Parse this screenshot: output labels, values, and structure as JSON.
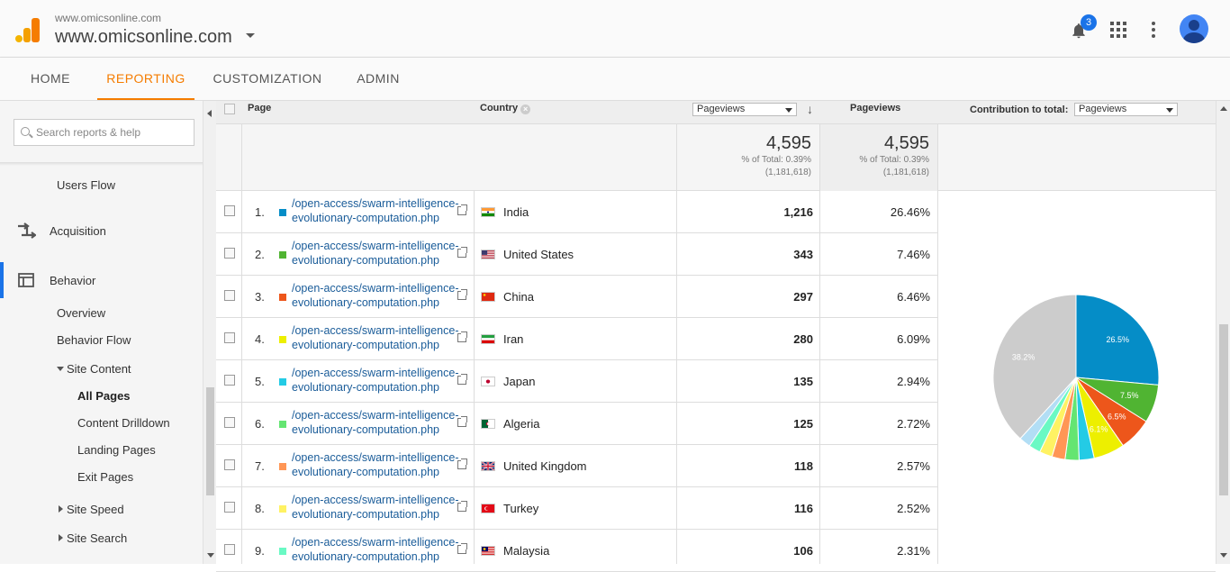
{
  "header": {
    "account_small": "www.omicsonline.com",
    "account_name": "www.omicsonline.com",
    "notifications_count": "3",
    "icons": [
      "analytics-logo-icon",
      "bell-icon",
      "apps-grid-icon",
      "more-vert-icon",
      "avatar-icon"
    ]
  },
  "nav": {
    "tabs": [
      "HOME",
      "REPORTING",
      "CUSTOMIZATION",
      "ADMIN"
    ],
    "active": "REPORTING",
    "accent_color": "#f57c00"
  },
  "sidebar": {
    "search_placeholder": "Search reports & help",
    "users_flow": "Users Flow",
    "acquisition": "Acquisition",
    "behavior": "Behavior",
    "overview": "Overview",
    "behavior_flow": "Behavior Flow",
    "site_content": "Site Content",
    "all_pages": "All Pages",
    "content_drilldown": "Content Drilldown",
    "landing_pages": "Landing Pages",
    "exit_pages": "Exit Pages",
    "site_speed": "Site Speed",
    "site_search": "Site Search",
    "accent_color": "#1a73e8"
  },
  "table": {
    "headers": {
      "page": "Page",
      "country": "Country",
      "metric_select": "Pageviews",
      "pageviews": "Pageviews",
      "contribution": "Contribution to total:",
      "contribution_select": "Pageviews"
    },
    "totals": {
      "value1": "4,595",
      "pct1": "% of Total: 0.39%",
      "base1": "(1,181,618)",
      "value2": "4,595",
      "pct2": "% of Total: 0.39%",
      "base2": "(1,181,618)"
    },
    "rows": [
      {
        "num": "1.",
        "page": "/open-access/swarm-intelligence-evolutionary-computation.php",
        "country": "India",
        "flag": "india",
        "pageviews": "1,216",
        "pct": "26.46%",
        "color": "#058dc7"
      },
      {
        "num": "2.",
        "page": "/open-access/swarm-intelligence-evolutionary-computation.php",
        "country": "United States",
        "flag": "us",
        "pageviews": "343",
        "pct": "7.46%",
        "color": "#50b432"
      },
      {
        "num": "3.",
        "page": "/open-access/swarm-intelligence-evolutionary-computation.php",
        "country": "China",
        "flag": "china",
        "pageviews": "297",
        "pct": "6.46%",
        "color": "#ed561b"
      },
      {
        "num": "4.",
        "page": "/open-access/swarm-intelligence-evolutionary-computation.php",
        "country": "Iran",
        "flag": "iran",
        "pageviews": "280",
        "pct": "6.09%",
        "color": "#edef00"
      },
      {
        "num": "5.",
        "page": "/open-access/swarm-intelligence-evolutionary-computation.php",
        "country": "Japan",
        "flag": "japan",
        "pageviews": "135",
        "pct": "2.94%",
        "color": "#24cbe5"
      },
      {
        "num": "6.",
        "page": "/open-access/swarm-intelligence-evolutionary-computation.php",
        "country": "Algeria",
        "flag": "algeria",
        "pageviews": "125",
        "pct": "2.72%",
        "color": "#64e572"
      },
      {
        "num": "7.",
        "page": "/open-access/swarm-intelligence-evolutionary-computation.php",
        "country": "United Kingdom",
        "flag": "uk",
        "pageviews": "118",
        "pct": "2.57%",
        "color": "#ff9655"
      },
      {
        "num": "8.",
        "page": "/open-access/swarm-intelligence-evolutionary-computation.php",
        "country": "Turkey",
        "flag": "turkey",
        "pageviews": "116",
        "pct": "2.52%",
        "color": "#fff263"
      },
      {
        "num": "9.",
        "page": "/open-access/swarm-intelligence-evolutionary-computation.php",
        "country": "Malaysia",
        "flag": "malaysia",
        "pageviews": "106",
        "pct": "2.31%",
        "color": "#6af9c4"
      }
    ]
  },
  "pie": {
    "slices": [
      {
        "value": 26.46,
        "color": "#058dc7",
        "label": "26.5%"
      },
      {
        "value": 7.46,
        "color": "#50b432",
        "label": "7.5%"
      },
      {
        "value": 6.46,
        "color": "#ed561b",
        "label": "6.5%"
      },
      {
        "value": 6.09,
        "color": "#edef00",
        "label": "6.1%"
      },
      {
        "value": 2.94,
        "color": "#24cbe5",
        "label": ""
      },
      {
        "value": 2.72,
        "color": "#64e572",
        "label": ""
      },
      {
        "value": 2.57,
        "color": "#ff9655",
        "label": ""
      },
      {
        "value": 2.52,
        "color": "#fff263",
        "label": ""
      },
      {
        "value": 2.31,
        "color": "#6af9c4",
        "label": ""
      },
      {
        "value": 2.25,
        "color": "#b2def5",
        "label": ""
      },
      {
        "value": 38.22,
        "color": "#cccccc",
        "label": "38.2%"
      }
    ]
  }
}
